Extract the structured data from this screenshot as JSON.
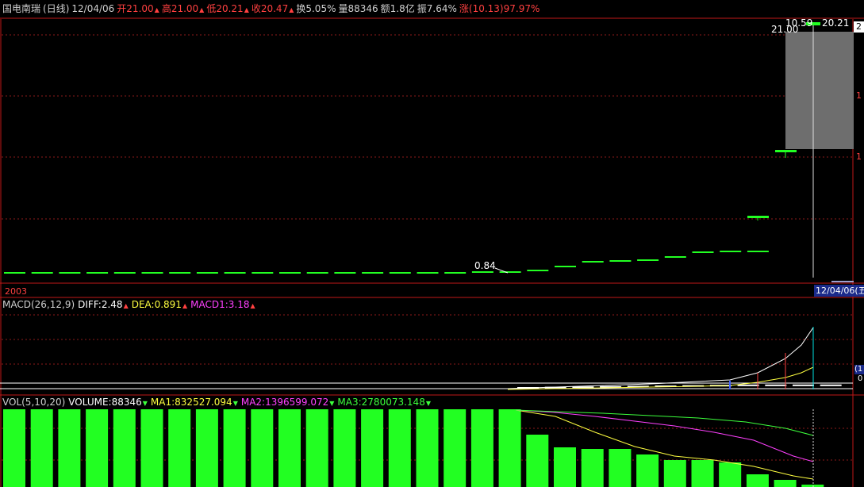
{
  "header": {
    "stock_name": "国电南瑞",
    "period": "(日线)",
    "date": "12/04/06",
    "open": "开21.00",
    "high": "高21.00",
    "low": "低20.21",
    "close": "收20.47",
    "turnover": "换5.05%",
    "volume": "量88346",
    "amount": "额1.8亿",
    "amplitude": "振7.64%",
    "change": "涨(10.13)97.97%"
  },
  "price_panel": {
    "year_label": "2003",
    "annot_low": "0.84",
    "annot_open": "21.00",
    "annot_hi1": "10.59",
    "annot_hi2": "20.21",
    "right_axis_top": "2",
    "right_axis_ticks": [
      "1",
      "1"
    ],
    "date_cursor": "12/04/06(五"
  },
  "macd_panel": {
    "title": "MACD(26,12,9)",
    "diff": "DIFF:2.48",
    "dea": "DEA:0.891",
    "macd1": "MACD1:3.18",
    "right_labels": [
      "(1",
      "0"
    ]
  },
  "vol_panel": {
    "title": "VOL(5,10,20)",
    "volume": "VOLUME:88346",
    "ma1": "MA1:832527.094",
    "ma2": "MA2:1396599.072",
    "ma3": "MA3:2780073.148"
  },
  "colors": {
    "up": "#ff4040",
    "down": "#3cff3c",
    "grid": "#8b1a1a",
    "frame": "#c01818",
    "ma_yellow": "#ffff40",
    "ma_magenta": "#ff40ff",
    "ma_green": "#3cff3c",
    "bar_green": "#22ff22"
  }
}
